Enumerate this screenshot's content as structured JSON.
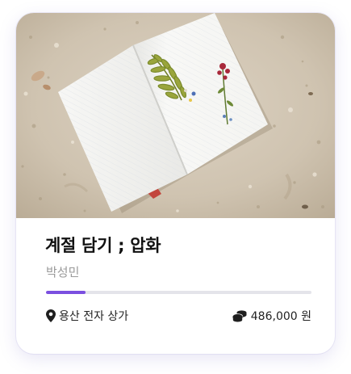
{
  "card": {
    "title": "계절 담기 ; 압화",
    "author": "박성민",
    "progress": 0.15,
    "location_icon": "map-pin-icon",
    "location": "용산 전자 상가",
    "price_icon": "coins-icon",
    "price": "486,000 원"
  },
  "colors": {
    "accent": "#7b4fe0",
    "track": "#e4e4ea"
  }
}
